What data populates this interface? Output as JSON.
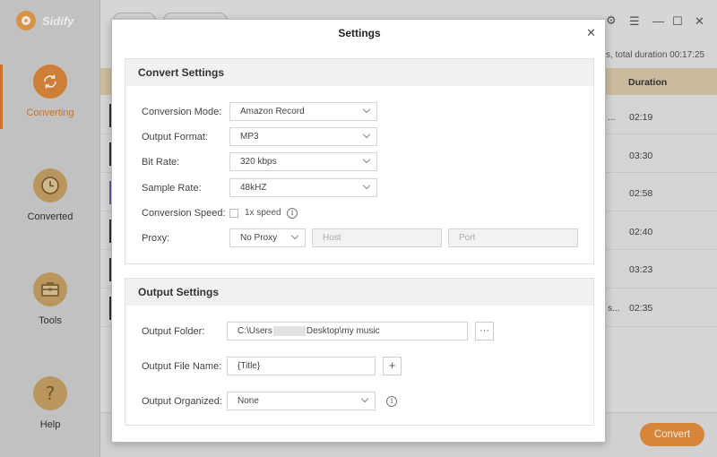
{
  "app": {
    "name": "Sidify"
  },
  "sidebar": {
    "items": [
      {
        "label": "Converting",
        "icon": "refresh-icon",
        "active": true
      },
      {
        "label": "Converted",
        "icon": "clock-icon",
        "active": false
      },
      {
        "label": "Tools",
        "icon": "toolbox-icon",
        "active": false
      },
      {
        "label": "Help",
        "icon": "question-icon",
        "active": false
      }
    ]
  },
  "main": {
    "summary": "s, total duration 00:17:25",
    "columns": {
      "duration": "Duration"
    },
    "rows": [
      {
        "duration": "02:19",
        "fragment": "..."
      },
      {
        "duration": "03:30",
        "fragment": ""
      },
      {
        "duration": "02:58",
        "fragment": ""
      },
      {
        "duration": "02:40",
        "fragment": ""
      },
      {
        "duration": "03:23",
        "fragment": ""
      },
      {
        "duration": "02:35",
        "fragment": "s..."
      }
    ],
    "convert_label": "Convert"
  },
  "dialog": {
    "title": "Settings",
    "convert_settings": {
      "heading": "Convert Settings",
      "conversion_mode": {
        "label": "Conversion Mode:",
        "value": "Amazon Record"
      },
      "output_format": {
        "label": "Output Format:",
        "value": "MP3"
      },
      "bit_rate": {
        "label": "Bit Rate:",
        "value": "320 kbps"
      },
      "sample_rate": {
        "label": "Sample Rate:",
        "value": "48kHZ"
      },
      "conversion_speed": {
        "label": "Conversion Speed:",
        "option": "1x speed",
        "checked": false
      },
      "proxy": {
        "label": "Proxy:",
        "value": "No Proxy",
        "host_placeholder": "Host",
        "port_placeholder": "Port"
      }
    },
    "output_settings": {
      "heading": "Output Settings",
      "output_folder": {
        "label": "Output Folder:",
        "value_prefix": "C:\\Users",
        "value_suffix": "Desktop\\my music",
        "browse": "···"
      },
      "output_file_name": {
        "label": "Output File Name:",
        "value": "{Title}",
        "add": "+"
      },
      "output_organized": {
        "label": "Output Organized:",
        "value": "None"
      }
    }
  },
  "colors": {
    "accent": "#e9913e",
    "sidebar": "#d2d2d2"
  }
}
